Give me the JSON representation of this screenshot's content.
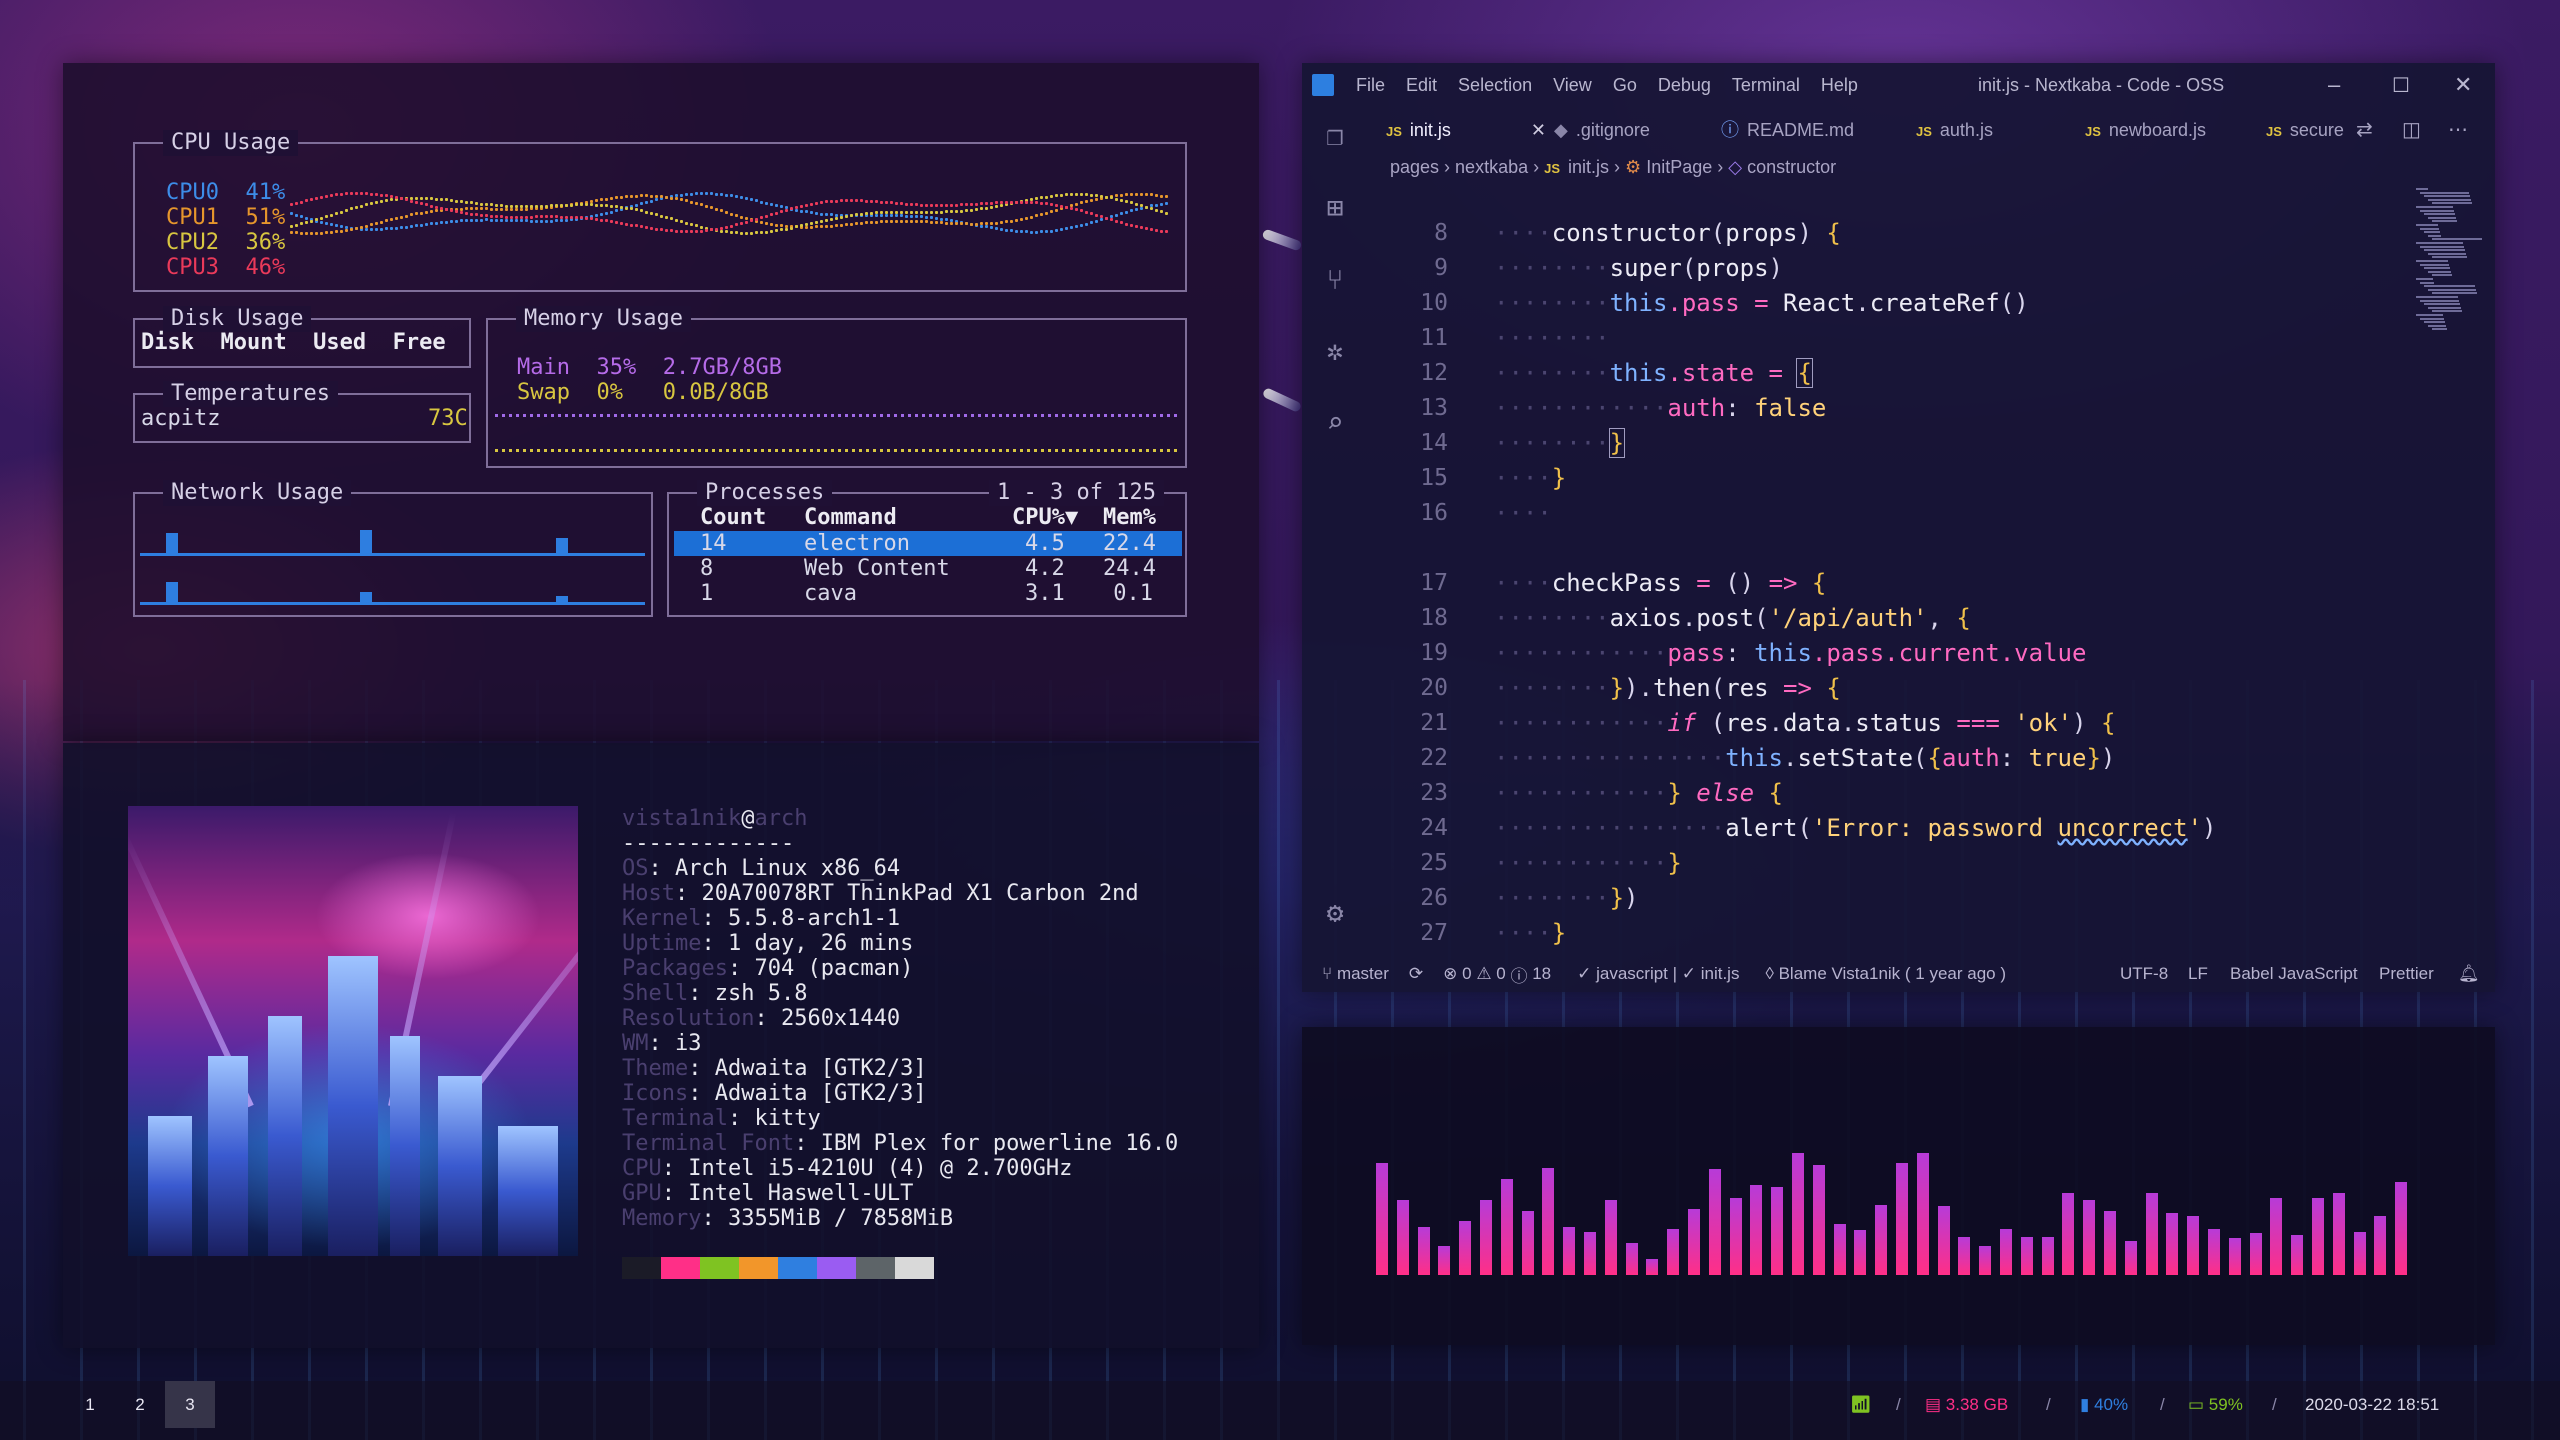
{
  "sysmon": {
    "cpu": {
      "title": "CPU Usage",
      "rows": [
        {
          "label": "CPU0",
          "pct": "41%"
        },
        {
          "label": "CPU1",
          "pct": "51%"
        },
        {
          "label": "CPU2",
          "pct": "36%"
        },
        {
          "label": "CPU3",
          "pct": "46%"
        }
      ]
    },
    "disk": {
      "title": "Disk Usage",
      "headers": "Disk  Mount  Used  Free"
    },
    "temps": {
      "title": "Temperatures",
      "sensor": "acpitz",
      "value": "73C"
    },
    "memory": {
      "title": "Memory Usage",
      "main": {
        "label": "Main",
        "pct": "35%",
        "amount": "2.7GB/8GB"
      },
      "swap": {
        "label": "Swap",
        "pct": "0%",
        "amount": "0.0B/8GB"
      }
    },
    "network": {
      "title": "Network Usage"
    },
    "processes": {
      "title": "Processes",
      "range": "1 - 3 of 125",
      "headers": {
        "count": "Count",
        "command": "Command",
        "cpu": "CPU%▼",
        "mem": "Mem%"
      },
      "rows": [
        {
          "count": "14",
          "command": "electron",
          "cpu": "4.5",
          "mem": "22.4"
        },
        {
          "count": "8",
          "command": "Web Content",
          "cpu": "4.2",
          "mem": "24.4"
        },
        {
          "count": "1",
          "command": "cava",
          "cpu": "3.1",
          "mem": "0.1"
        }
      ]
    }
  },
  "neofetch": {
    "user": "vista1nik",
    "at": "@",
    "host": "arch",
    "sep": "-------------",
    "lines": [
      {
        "k": "OS",
        "v": "Arch Linux x86_64"
      },
      {
        "k": "Host",
        "v": "20A70078RT ThinkPad X1 Carbon 2nd"
      },
      {
        "k": "Kernel",
        "v": "5.5.8-arch1-1"
      },
      {
        "k": "Uptime",
        "v": "1 day, 26 mins"
      },
      {
        "k": "Packages",
        "v": "704 (pacman)"
      },
      {
        "k": "Shell",
        "v": "zsh 5.8"
      },
      {
        "k": "Resolution",
        "v": "2560x1440"
      },
      {
        "k": "WM",
        "v": "i3"
      },
      {
        "k": "Theme",
        "v": "Adwaita [GTK2/3]"
      },
      {
        "k": "Icons",
        "v": "Adwaita [GTK2/3]"
      },
      {
        "k": "Terminal",
        "v": "kitty"
      },
      {
        "k": "Terminal Font",
        "v": "IBM Plex for powerline 16.0"
      },
      {
        "k": "CPU",
        "v": "Intel i5-4210U (4) @ 2.700GHz"
      },
      {
        "k": "GPU",
        "v": "Intel Haswell-ULT"
      },
      {
        "k": "Memory",
        "v": "3355MiB / 7858MiB"
      }
    ],
    "swatches": [
      "#1b1b27",
      "#ff2f87",
      "#7fc322",
      "#f2962a",
      "#2f7fe0",
      "#9a5cf2",
      "#5d6468",
      "#d9d9d9"
    ]
  },
  "editor": {
    "menu": [
      "File",
      "Edit",
      "Selection",
      "View",
      "Go",
      "Debug",
      "Terminal",
      "Help"
    ],
    "window_title": "init.js - Nextkaba - Code - OSS",
    "tabs": [
      "init.js",
      ".gitignore",
      "README.md",
      "auth.js",
      "newboard.js",
      "secure"
    ],
    "breadcrumbs": [
      "pages",
      "nextkaba",
      "init.js",
      "InitPage",
      "constructor"
    ],
    "line_numbers": [
      "8",
      "9",
      "10",
      "11",
      "12",
      "13",
      "14",
      "15",
      "16",
      "17",
      "18",
      "19",
      "20",
      "21",
      "22",
      "23",
      "24",
      "25",
      "26",
      "27"
    ],
    "status": {
      "branch": "master",
      "problems": "0",
      "warnings": "0",
      "info": "18",
      "lint": "javascript | ✓ init.js",
      "blame": "Blame Vista1nik ( 1 year ago )",
      "encoding": "UTF-8",
      "eol": "LF",
      "language": "Babel JavaScript",
      "formatter": "Prettier"
    }
  },
  "visualizer": {
    "levels": [
      0.7,
      0.47,
      0.3,
      0.18,
      0.34,
      0.47,
      0.6,
      0.4,
      0.67,
      0.3,
      0.27,
      0.47,
      0.2,
      0.1,
      0.29,
      0.41,
      0.66,
      0.48,
      0.56,
      0.55,
      0.76,
      0.69,
      0.32,
      0.28,
      0.44,
      0.7,
      0.76,
      0.43,
      0.24,
      0.18,
      0.29,
      0.24,
      0.24,
      0.51,
      0.47,
      0.4,
      0.21,
      0.51,
      0.39,
      0.37,
      0.29,
      0.23,
      0.26,
      0.48,
      0.25,
      0.48,
      0.51,
      0.27,
      0.37,
      0.58
    ]
  },
  "bar": {
    "workspaces": [
      "1",
      "2",
      "3"
    ],
    "active_workspace": "3",
    "memory": "3.38 GB",
    "volume": "40%",
    "battery": "59%",
    "datetime": "2020-03-22 18:51",
    "sep": "/"
  },
  "colors": {
    "cpu0": "#3d8de8",
    "cpu1": "#e6962c",
    "cpu2": "#d8c640",
    "cpu3": "#ea3a5a",
    "accent": "#ff2f87",
    "selection": "#1c6fd6"
  }
}
